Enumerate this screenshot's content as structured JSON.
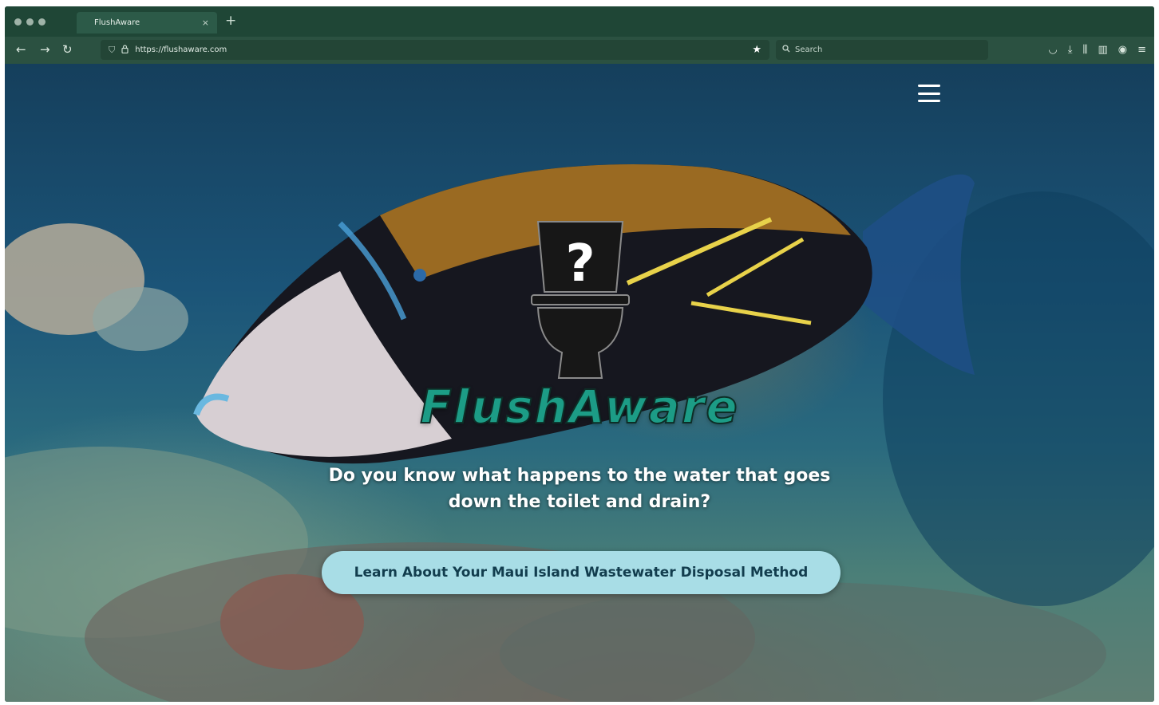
{
  "browser": {
    "tab_title": "FlushAware",
    "tab_close": "×",
    "new_tab": "+",
    "url": "https://flushaware.com",
    "search_placeholder": "Search"
  },
  "icons": {
    "back": "back-arrow-icon",
    "forward": "forward-arrow-icon",
    "reload": "reload-icon",
    "shield": "shield-icon",
    "lock": "lock-icon",
    "star": "bookmark-star-icon",
    "search": "search-icon",
    "pocket": "pocket-icon",
    "download": "download-icon",
    "library": "library-icon",
    "sidebar": "sidebar-icon",
    "account": "account-icon",
    "menu": "app-menu-icon",
    "hamburger": "hamburger-menu-icon",
    "logo": "toilet-question-logo-icon"
  },
  "hero": {
    "logo_symbol": "?",
    "brand": "FlushAware",
    "headline_line1": "Do you know what happens to the water that goes",
    "headline_line2": "down the toilet and drain?",
    "cta_label": "Learn About Your Maui Island Wastewater Disposal Method"
  },
  "colors": {
    "browser_chrome": "#2b5141",
    "brand_teal": "#1c9c86",
    "cta_background": "#a8dde6",
    "cta_text": "#123d4e"
  }
}
